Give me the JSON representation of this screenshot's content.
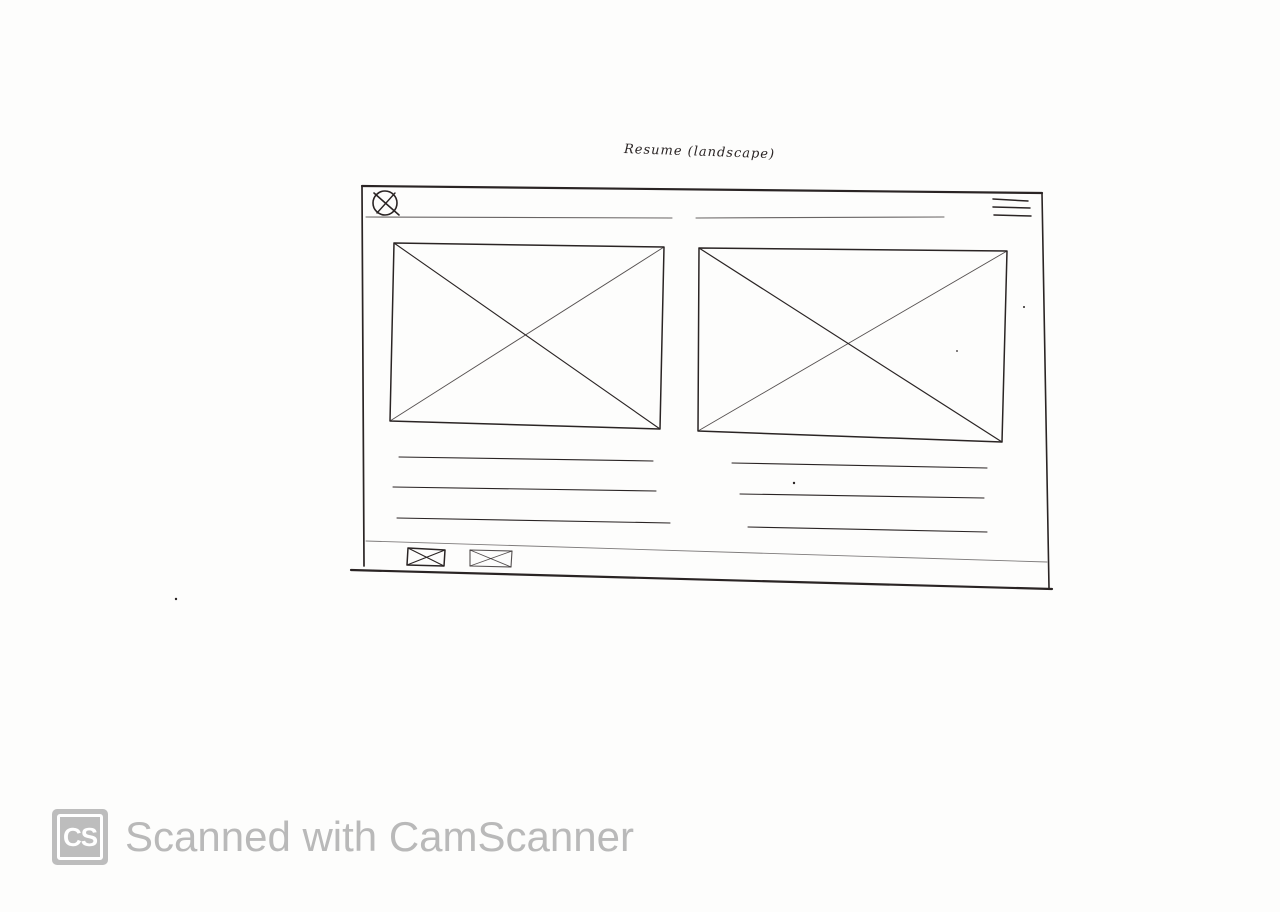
{
  "sketch": {
    "title": "Resume (landscape)",
    "left_gallery_image": "image-placeholder",
    "right_gallery_image": "image-placeholder",
    "left_caption_line_count": 3,
    "right_caption_line_count": 3,
    "footer_thumbnail_count": 2
  },
  "icons": {
    "close": "close-icon",
    "menu": "hamburger-menu-icon",
    "image_placeholder": "crossed-box-icon"
  },
  "watermark": {
    "logo_text": "CS",
    "text": "Scanned with CamScanner"
  },
  "colors": {
    "ink": "#2a2424",
    "paper": "#fdfdfc",
    "watermark_gray": "#b9b9b9"
  }
}
